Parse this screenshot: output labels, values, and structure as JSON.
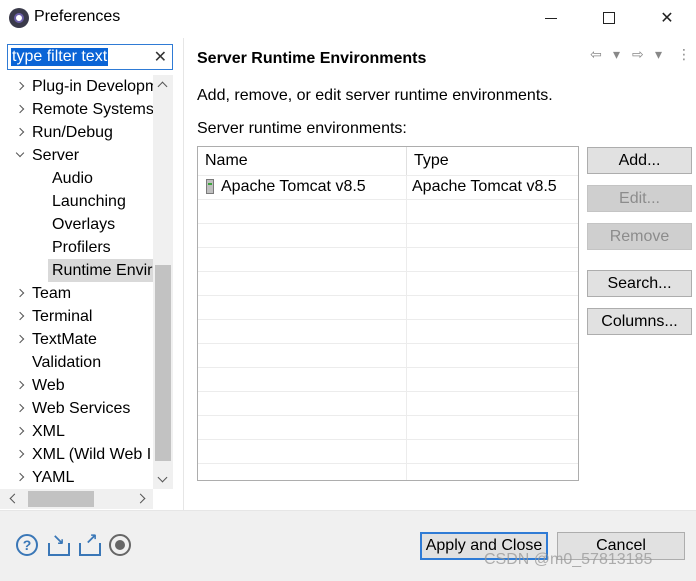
{
  "window": {
    "title": "Preferences",
    "minimize": "—",
    "maximize": "☐",
    "close": "✕"
  },
  "filter": {
    "text": "type filter text",
    "clear": "✕"
  },
  "tree": [
    {
      "label": "Plug-in Developm",
      "indent": 0,
      "chevron": "right"
    },
    {
      "label": "Remote Systems",
      "indent": 0,
      "chevron": "right"
    },
    {
      "label": "Run/Debug",
      "indent": 0,
      "chevron": "right"
    },
    {
      "label": "Server",
      "indent": 0,
      "chevron": "down"
    },
    {
      "label": "Audio",
      "indent": 1,
      "chevron": "none"
    },
    {
      "label": "Launching",
      "indent": 1,
      "chevron": "none"
    },
    {
      "label": "Overlays",
      "indent": 1,
      "chevron": "none"
    },
    {
      "label": "Profilers",
      "indent": 1,
      "chevron": "none"
    },
    {
      "label": "Runtime Envir",
      "indent": 1,
      "chevron": "none",
      "selected": true
    },
    {
      "label": "Team",
      "indent": 0,
      "chevron": "right"
    },
    {
      "label": "Terminal",
      "indent": 0,
      "chevron": "right"
    },
    {
      "label": "TextMate",
      "indent": 0,
      "chevron": "right"
    },
    {
      "label": "Validation",
      "indent": 0,
      "chevron": "none"
    },
    {
      "label": "Web",
      "indent": 0,
      "chevron": "right"
    },
    {
      "label": "Web Services",
      "indent": 0,
      "chevron": "right"
    },
    {
      "label": "XML",
      "indent": 0,
      "chevron": "right"
    },
    {
      "label": "XML (Wild Web I",
      "indent": 0,
      "chevron": "right"
    },
    {
      "label": "YAML",
      "indent": 0,
      "chevron": "right"
    }
  ],
  "page": {
    "title": "Server Runtime Environments",
    "description": "Add, remove, or edit server runtime environments.",
    "list_label": "Server runtime environments:",
    "nav": {
      "back": "⇦",
      "back_menu": "▾",
      "forward": "⇨",
      "forward_menu": "▾",
      "more": "⋮"
    }
  },
  "table": {
    "columns": [
      "Name",
      "Type"
    ],
    "rows": [
      {
        "name": "Apache Tomcat v8.5",
        "type": "Apache Tomcat v8.5",
        "icon": "server-icon"
      }
    ]
  },
  "buttons": {
    "add": "Add...",
    "edit": "Edit...",
    "remove": "Remove",
    "search": "Search...",
    "columns": "Columns..."
  },
  "footer": {
    "help": "?",
    "apply_close": "Apply and Close",
    "cancel": "Cancel",
    "watermark": "CSDN @m0_57813185"
  }
}
